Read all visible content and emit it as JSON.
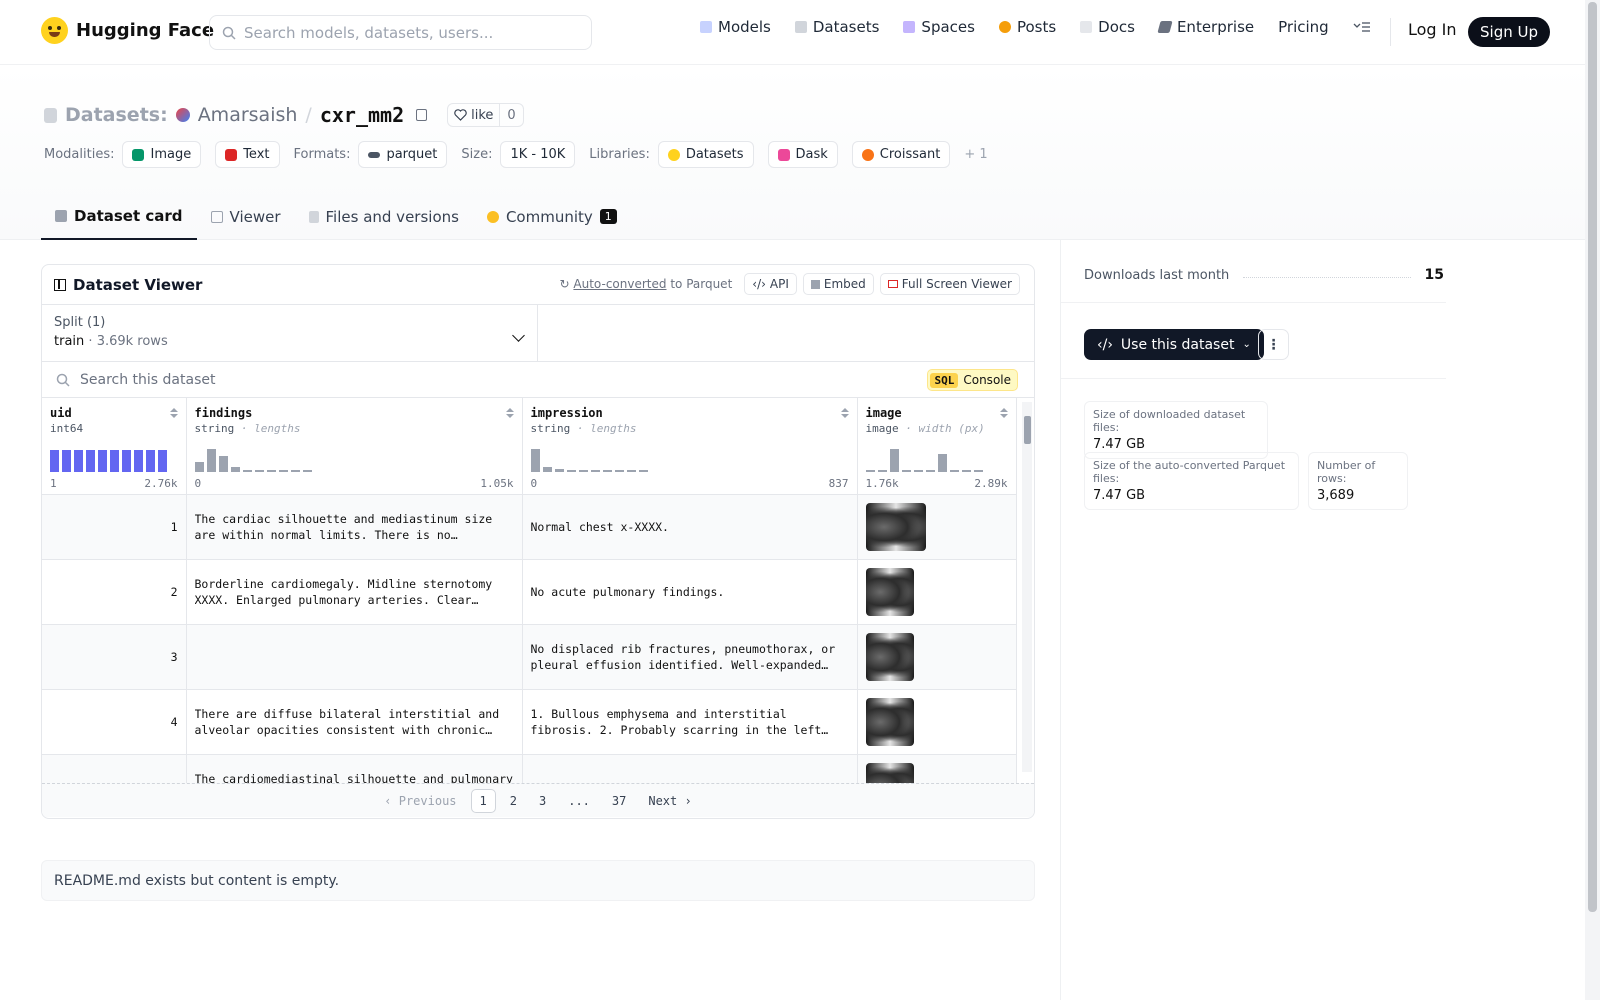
{
  "nav": {
    "brand": "Hugging Face",
    "search_placeholder": "Search models, datasets, users...",
    "links": [
      "Models",
      "Datasets",
      "Spaces",
      "Posts",
      "Docs",
      "Enterprise",
      "Pricing"
    ],
    "login": "Log In",
    "signup": "Sign Up"
  },
  "header": {
    "section": "Datasets:",
    "owner": "Amarsaish",
    "separator": "/",
    "repo": "cxr_mm2",
    "like_label": "like",
    "like_count": "0",
    "modalities_label": "Modalities:",
    "modalities": [
      "Image",
      "Text"
    ],
    "formats_label": "Formats:",
    "format": "parquet",
    "size_label": "Size:",
    "size": "1K - 10K",
    "libraries_label": "Libraries:",
    "libraries": [
      "Datasets",
      "Dask",
      "Croissant"
    ],
    "libraries_more": "+ 1"
  },
  "tabs": [
    {
      "label": "Dataset card",
      "active": true
    },
    {
      "label": "Viewer",
      "active": false
    },
    {
      "label": "Files and versions",
      "active": false
    },
    {
      "label": "Community",
      "active": false,
      "badge": "1"
    }
  ],
  "viewer": {
    "title": "Dataset Viewer",
    "autoconv_link": "Auto-converted",
    "autoconv_text": "to Parquet",
    "api": "API",
    "embed": "Embed",
    "fullscreen": "Full Screen Viewer",
    "split_label": "Split (1)",
    "split_value": "train",
    "split_sep": "·",
    "split_rows": "3.69k rows",
    "search_placeholder": "Search this dataset",
    "sql_tag": "SQL",
    "sql_label": "Console",
    "columns": [
      {
        "name": "uid",
        "type": "int64",
        "hint": "",
        "min": "1",
        "max": "2.76k",
        "hist": [
          0.85,
          0.85,
          0.85,
          0.85,
          0.85,
          0.85,
          0.85,
          0.85,
          0.85,
          0.85
        ],
        "color": "#6366f1"
      },
      {
        "name": "findings",
        "type": "string",
        "hint": "· lengths",
        "min": "0",
        "max": "1.05k",
        "hist": [
          0.4,
          0.9,
          0.6,
          0.2,
          0.05,
          0.05,
          0.05,
          0.05,
          0.05,
          0.05
        ],
        "color": "#9ca3af"
      },
      {
        "name": "impression",
        "type": "string",
        "hint": "· lengths",
        "min": "0",
        "max": "837",
        "hist": [
          0.9,
          0.2,
          0.1,
          0.05,
          0.05,
          0.05,
          0.05,
          0.05,
          0,
          0.05
        ],
        "color": "#9ca3af"
      },
      {
        "name": "image",
        "type": "image",
        "hint": "· width (px)",
        "min": "1.76k",
        "max": "2.89k",
        "hist": [
          0.05,
          0,
          0.9,
          0.05,
          0.05,
          0.05,
          0.7,
          0.05,
          0.05,
          0.05
        ],
        "color": "#9ca3af"
      }
    ],
    "rows": [
      {
        "uid": "1",
        "findings": "The cardiac silhouette and mediastinum size are within normal limits. There is no pneumothorax.",
        "impression": "Normal chest x-XXXX."
      },
      {
        "uid": "2",
        "findings": "Borderline cardiomegaly. Midline sternotomy XXXX. Enlarged pulmonary arteries. Clear lungs.",
        "impression": "No acute pulmonary findings."
      },
      {
        "uid": "3",
        "findings": "",
        "impression": "No displaced rib fractures, pneumothorax, or pleural effusion identified. Well-expanded and clear lungs."
      },
      {
        "uid": "4",
        "findings": "There are diffuse bilateral interstitial and alveolar opacities consistent with chronic obstructive lung disease.",
        "impression": "1. Bullous emphysema and interstitial fibrosis. 2. Probably scarring in the left apex."
      },
      {
        "uid": "",
        "findings": "The cardiomediastinal silhouette and pulmonary vasculature are within normal limits.",
        "impression": ""
      }
    ],
    "pager": {
      "prev": "Previous",
      "pages": [
        "1",
        "2",
        "3",
        "...",
        "37"
      ],
      "next": "Next"
    }
  },
  "readme": "README.md exists but content is empty.",
  "sidebar": {
    "downloads_label": "Downloads last month",
    "downloads_value": "15",
    "use_button": "Use this dataset",
    "kebab": "⋮",
    "stats": [
      {
        "label": "Size of downloaded dataset files:",
        "value": "7.47 GB"
      },
      {
        "label": "Size of the auto-converted Parquet files:",
        "value": "7.47 GB"
      },
      {
        "label": "Number of rows:",
        "value": "3,689"
      }
    ]
  },
  "colors": {
    "brand_yellow": "#ffd21e",
    "dark": "#111827",
    "uid_hist": "#6366f1",
    "sql_yellow": "#fcd34d"
  }
}
